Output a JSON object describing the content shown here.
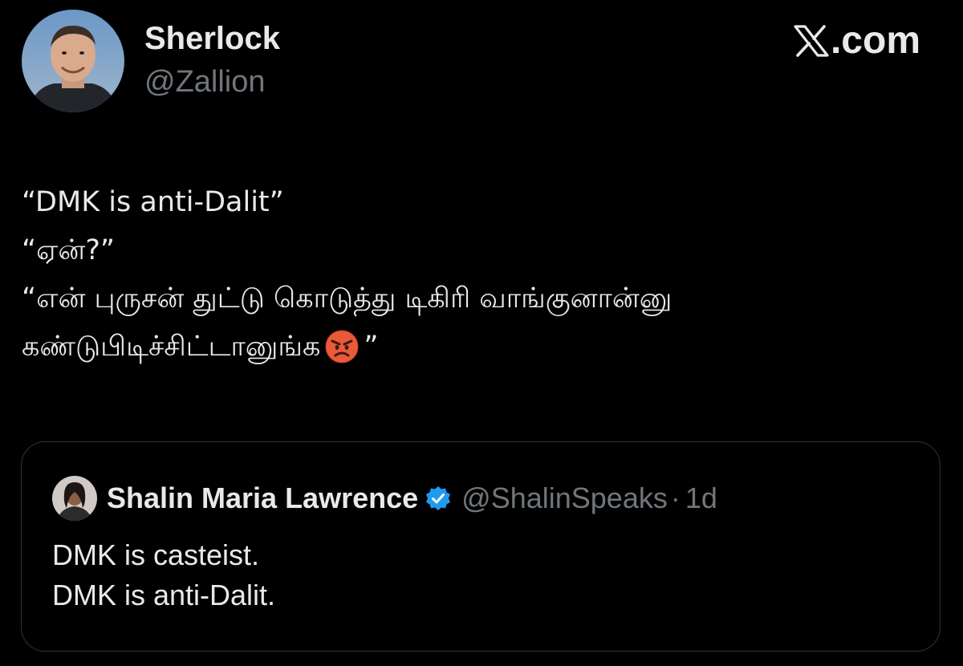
{
  "author": {
    "name": "Sherlock",
    "handle": "@Zallion",
    "avatar_icon": "profile-photo-avatar"
  },
  "brand": {
    "logo_icon": "x-logo-icon",
    "text": ".com"
  },
  "tweet": {
    "lines": [
      "“DMK is anti-Dalit”",
      "“ஏன்?”",
      "“என் புருசன் துட்டு கொடுத்து டிகிரி வாங்குனான்னு",
      "கண்டுபிடிச்சிட்டானுங்க",
      "”"
    ],
    "emoji": "angry-face-emoji"
  },
  "quote": {
    "name": "Shalin Maria Lawrence",
    "handle": "@ShalinSpeaks",
    "separator": "·",
    "time": "1d",
    "verified_icon": "verified-badge-icon",
    "lines": [
      "DMK is casteist.",
      "DMK is anti-Dalit."
    ]
  },
  "colors": {
    "background": "#000000",
    "text_primary": "#e7e9ea",
    "text_secondary": "#71767b",
    "border": "#2f3336",
    "verified_blue": "#1d9bf0"
  }
}
